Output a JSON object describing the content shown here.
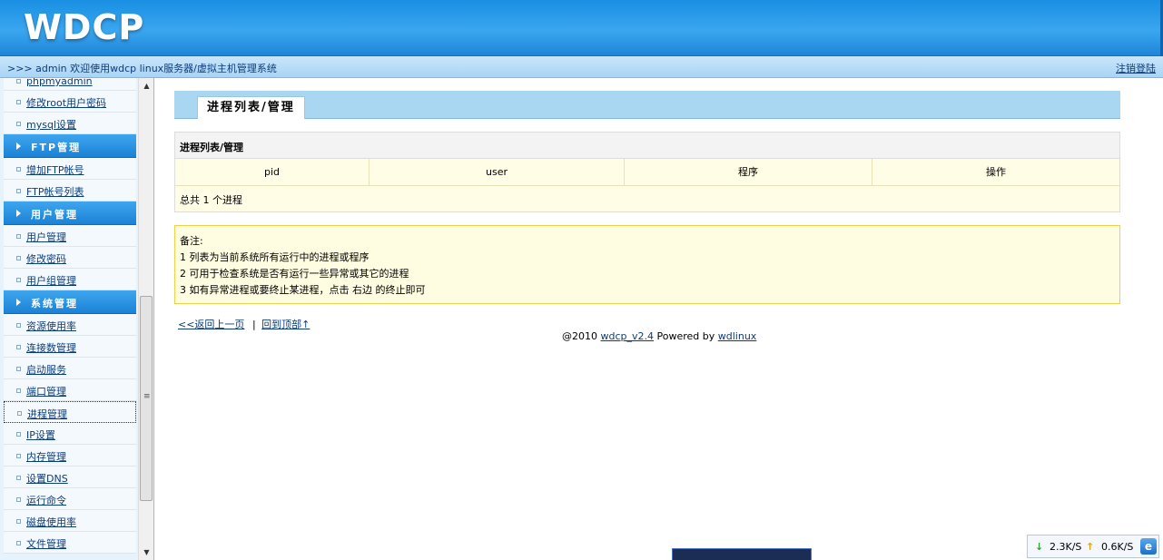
{
  "header": {
    "logo": "WDCP"
  },
  "infobar": {
    "welcome": ">>> admin 欢迎使用wdcp linux服务器/虚拟主机管理系统",
    "logout": "注销登陆"
  },
  "sidebar": {
    "items": [
      {
        "type": "item",
        "label": "phpmyadmin"
      },
      {
        "type": "item",
        "label": "修改root用户密码"
      },
      {
        "type": "item",
        "label": "mysql设置"
      },
      {
        "type": "group",
        "label": "FTP管理"
      },
      {
        "type": "item",
        "label": "增加FTP帐号"
      },
      {
        "type": "item",
        "label": "FTP帐号列表"
      },
      {
        "type": "group",
        "label": "用户管理"
      },
      {
        "type": "item",
        "label": "用户管理"
      },
      {
        "type": "item",
        "label": "修改密码"
      },
      {
        "type": "item",
        "label": "用户组管理"
      },
      {
        "type": "group",
        "label": "系统管理"
      },
      {
        "type": "item",
        "label": "资源使用率"
      },
      {
        "type": "item",
        "label": "连接数管理"
      },
      {
        "type": "item",
        "label": "启动服务"
      },
      {
        "type": "item",
        "label": "端口管理"
      },
      {
        "type": "item",
        "label": "进程管理",
        "selected": true
      },
      {
        "type": "item",
        "label": "IP设置"
      },
      {
        "type": "item",
        "label": "内存管理"
      },
      {
        "type": "item",
        "label": "设置DNS"
      },
      {
        "type": "item",
        "label": "运行命令"
      },
      {
        "type": "item",
        "label": "磁盘使用率"
      },
      {
        "type": "item",
        "label": "文件管理"
      }
    ]
  },
  "main": {
    "tab_title": "进程列表/管理",
    "table": {
      "caption": "进程列表/管理",
      "columns": [
        "pid",
        "user",
        "程序",
        "操作"
      ],
      "total": "总共  1 个进程"
    },
    "notes": [
      "备注:",
      "1 列表为当前系统所有运行中的进程或程序",
      "2 可用于检查系统是否有运行一些异常或其它的进程",
      "3 如有异常进程或要终止某进程，点击  右边  的终止即可"
    ],
    "links": {
      "back": "<<返回上一页",
      "separator": "|",
      "top": "回到顶部↑"
    },
    "copyright": {
      "prefix": "@2010 ",
      "version": "wdcp_v2.4",
      "powered": " Powered by ",
      "vendor": "wdlinux"
    }
  },
  "tray": {
    "download_speed": "2.3K/S",
    "upload_speed": "0.6K/S",
    "down_arrow": "↓",
    "up_arrow": "↑",
    "browser_glyph": "e"
  }
}
